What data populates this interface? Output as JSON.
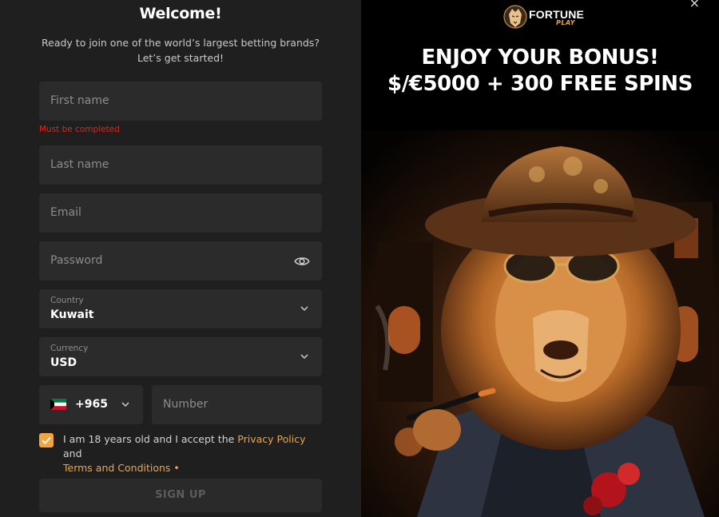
{
  "form": {
    "title": "Welcome!",
    "subtitle": "Ready to join one of the world’s largest betting brands? Let’s get started!",
    "first_name": {
      "placeholder": "First name",
      "error": "Must be completed"
    },
    "last_name": {
      "placeholder": "Last name"
    },
    "email": {
      "placeholder": "Email"
    },
    "password": {
      "placeholder": "Password"
    },
    "country": {
      "label": "Country",
      "value": "Kuwait"
    },
    "currency": {
      "label": "Currency",
      "value": "USD"
    },
    "phone": {
      "code": "+965",
      "placeholder": "Number"
    },
    "consent": {
      "text_before": "I am 18 years old and I accept the ",
      "privacy_link": "Privacy Policy",
      "text_mid": " and",
      "terms_link": "Terms and Conditions",
      "required_mark": " •",
      "checked": true
    },
    "signup_label": "SIGN UP"
  },
  "promo": {
    "logo_word1": "FORTUNE",
    "logo_word2": "PLAY",
    "headline_line1": "ENJOY YOUR BONUS!",
    "headline_line2": "$/€5000 + 300 FREE SPINS"
  },
  "close_symbol": "×",
  "colors": {
    "accent": "#f0a443",
    "error": "#e3231b",
    "panel_bg": "#1f1f1f",
    "field_bg": "#2b2b2b"
  },
  "icons": [
    "eye-icon",
    "chevron-down-icon",
    "kuwait-flag-icon",
    "check-icon",
    "close-icon",
    "lion-logo-icon"
  ]
}
